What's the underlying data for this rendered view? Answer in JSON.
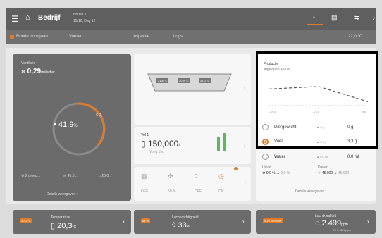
{
  "header": {
    "title": "Bedrijf",
    "house_name": "House 1",
    "house_date": "15/10, Dag 12",
    "outside_temp": "22,0 °C"
  },
  "subbar": {
    "round_check": "Ronde doorgaan",
    "feed": "Voeren",
    "inspection": "Inspectie",
    "log": "Logs"
  },
  "left_card": {
    "title": "Ventilatie",
    "value": "0,29",
    "unit": "m³/u/dier",
    "gauge_value": "41,9",
    "gauge_unit": "%",
    "gauge_label": "CO₂",
    "groups": "2 groep...",
    "v2": "45,0...",
    "v3": "20,0...",
    "details": "Details weergeven"
  },
  "middle": {
    "tray_temps": [
      "21,8 °C",
      "20,9 °C",
      "21,0 °C"
    ],
    "birds_title": "Vol 1",
    "birds_value": "150,000",
    "birds_unit": "t",
    "birds_sub": "Vorig dvd",
    "bottom_labels": [
      "OFF",
      "50 %",
      "OFF",
      "ON"
    ]
  },
  "production": {
    "title": "Productie",
    "subtitle": "Afgelopen 48 uur",
    "x_labels": [
      "-48 u",
      "-24 u",
      "Nu"
    ],
    "rows": [
      {
        "label": "Diergewicht",
        "delta": "▲ 0 g",
        "value": "0 g",
        "selected": false
      },
      {
        "label": "Voer",
        "delta": "▲ 3,3 g",
        "value": "3,3 g",
        "selected": true
      },
      {
        "label": "Water",
        "delta": "▲ 0,0 ml",
        "value": "0,0 ml",
        "selected": false
      }
    ],
    "uitval_label": "Uitval",
    "uitval_value": "0,0 %",
    "uitval_sub": "▲ 0,0 %",
    "dieren_label": "Dieren",
    "dieren_value": "45.000",
    "dieren_sub": "▲ 45.000",
    "details": "Details weergeven"
  },
  "chart_data": {
    "type": "line",
    "x": [
      "-48 u",
      "-24 u",
      "Nu"
    ],
    "series": [
      {
        "values": [
          0.6,
          0.7,
          0.1
        ]
      }
    ]
  },
  "bottom": [
    {
      "badge": "20,0 °C",
      "title": "Temperatuur",
      "value": "20,3",
      "unit": "°C",
      "sub": ""
    },
    {
      "badge": "54 %",
      "title": "Luchtvochtigheid",
      "value": "33",
      "unit": "%",
      "sub": ""
    },
    {
      "badge": "0,29 m³/u/dier",
      "title": "Luchtkwaliteit",
      "value": "2.499",
      "unit": "ppm",
      "sub": "NH₃ 38,1 ppm"
    }
  ]
}
